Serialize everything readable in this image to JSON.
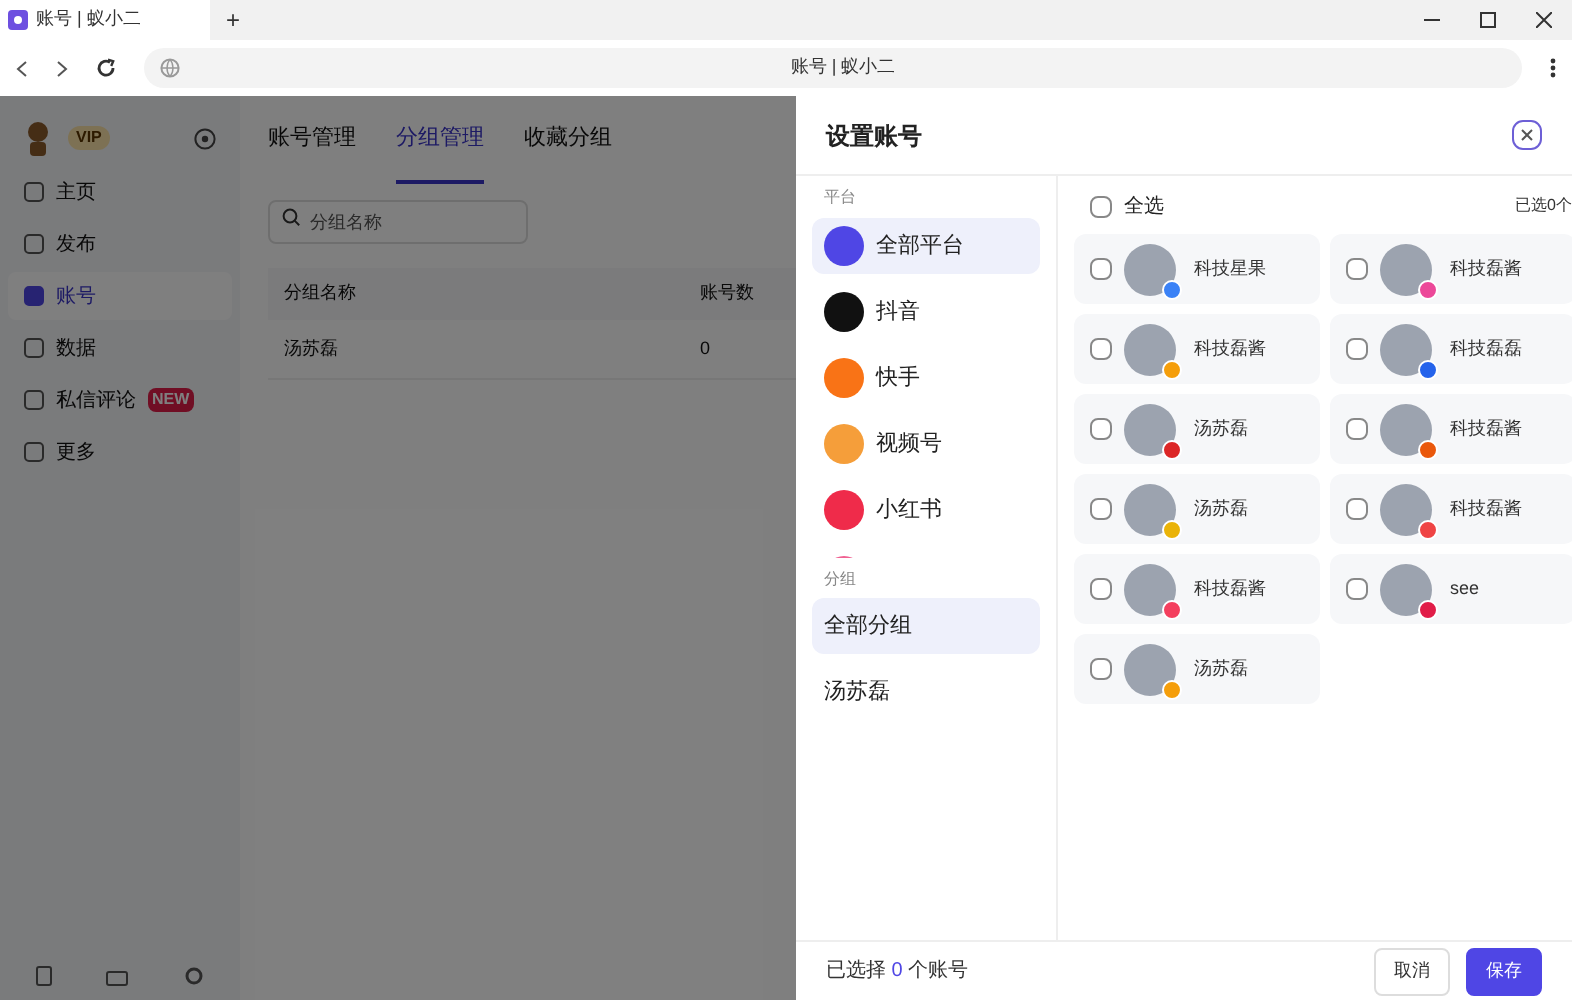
{
  "browser": {
    "tab_title": "账号 | 蚁小二",
    "new_tab": "+",
    "address": "账号 | 蚁小二"
  },
  "app": {
    "badge": "VIP",
    "nav": [
      {
        "label": "主页",
        "selected": false
      },
      {
        "label": "发布",
        "selected": false
      },
      {
        "label": "账号",
        "selected": true
      },
      {
        "label": "数据",
        "selected": false
      },
      {
        "label": "私信评论",
        "selected": false,
        "tag": "NEW"
      },
      {
        "label": "更多",
        "selected": false
      }
    ],
    "tabs": [
      {
        "label": "账号管理",
        "selected": false
      },
      {
        "label": "分组管理",
        "selected": true
      },
      {
        "label": "收藏分组",
        "selected": false
      }
    ],
    "search": {
      "placeholder": "分组名称"
    },
    "table": {
      "columns": [
        "分组名称",
        "账号数"
      ],
      "rows": [
        [
          "汤苏磊",
          "0"
        ]
      ]
    }
  },
  "drawer": {
    "title": "设置账号",
    "platform_label": "平台",
    "platforms": [
      {
        "label": "全部平台",
        "selected": true,
        "color": "#4f46e5"
      },
      {
        "label": "抖音",
        "selected": false,
        "color": "#111111"
      },
      {
        "label": "快手",
        "selected": false,
        "color": "#f97316"
      },
      {
        "label": "视频号",
        "selected": false,
        "color": "#f59e3a"
      },
      {
        "label": "小红书",
        "selected": false,
        "color": "#ef2b4a"
      }
    ],
    "group_label": "分组",
    "groups": [
      {
        "label": "全部分组",
        "selected": true
      },
      {
        "label": "汤苏磊",
        "selected": false
      }
    ],
    "select_all": {
      "label": "全选",
      "checked": false
    },
    "selected_count": "已选0个",
    "accounts": [
      {
        "name": "科技星果",
        "checked": false,
        "color": "#3b82f6"
      },
      {
        "name": "科技磊酱",
        "checked": false,
        "color": "#ec4899"
      },
      {
        "name": "科技磊酱",
        "checked": false,
        "color": "#f59e0b"
      },
      {
        "name": "科技磊磊",
        "checked": false,
        "color": "#2563eb"
      },
      {
        "name": "汤苏磊",
        "checked": false,
        "color": "#dc2626"
      },
      {
        "name": "科技磊酱",
        "checked": false,
        "color": "#ea580c"
      },
      {
        "name": "汤苏磊",
        "checked": false,
        "color": "#eab308"
      },
      {
        "name": "科技磊酱",
        "checked": false,
        "color": "#ef4444"
      },
      {
        "name": "科技磊酱",
        "checked": false,
        "color": "#f43f5e"
      },
      {
        "name": "see",
        "checked": false,
        "color": "#e11d48"
      },
      {
        "name": "汤苏磊",
        "checked": false,
        "color": "#f59e0b"
      }
    ],
    "footer_text": "已选择 **0** 个账号",
    "buttons": [
      {
        "label": "取消",
        "kind": "secondary"
      },
      {
        "label": "保存",
        "kind": "primary"
      }
    ]
  }
}
